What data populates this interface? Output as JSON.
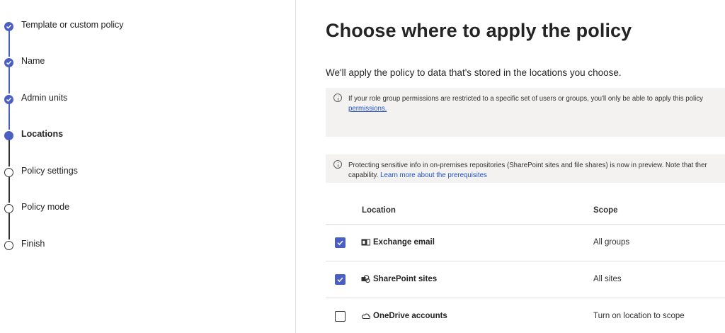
{
  "wizard": {
    "steps": [
      {
        "label": "Template or custom policy",
        "state": "done"
      },
      {
        "label": "Name",
        "state": "done"
      },
      {
        "label": "Admin units",
        "state": "done"
      },
      {
        "label": "Locations",
        "state": "current"
      },
      {
        "label": "Policy settings",
        "state": "todo"
      },
      {
        "label": "Policy mode",
        "state": "todo"
      },
      {
        "label": "Finish",
        "state": "todo"
      }
    ]
  },
  "main": {
    "title": "Choose where to apply the policy",
    "description": "We'll apply the policy to data that's stored in the locations you choose.",
    "info1": {
      "text": "If your role group permissions are restricted to a specific set of users or groups, you'll only be able to apply this policy",
      "link": "permissions."
    },
    "info2": {
      "text": "Protecting sensitive info in on-premises repositories (SharePoint sites and file shares) is now in preview. Note that ther",
      "text2": "capability.",
      "link": "Learn more about the prerequisites"
    },
    "table": {
      "headers": {
        "location": "Location",
        "scope": "Scope"
      },
      "rows": [
        {
          "location": "Exchange email",
          "scope": "All groups",
          "checked": true,
          "icon": "exchange-icon"
        },
        {
          "location": "SharePoint sites",
          "scope": "All sites",
          "checked": true,
          "icon": "sharepoint-icon"
        },
        {
          "location": "OneDrive accounts",
          "scope": "Turn on location to scope",
          "checked": false,
          "icon": "onedrive-icon"
        }
      ]
    }
  },
  "colors": {
    "accent": "#4a5fc1",
    "link": "#2452c4",
    "infobox": "#f3f2f1"
  }
}
